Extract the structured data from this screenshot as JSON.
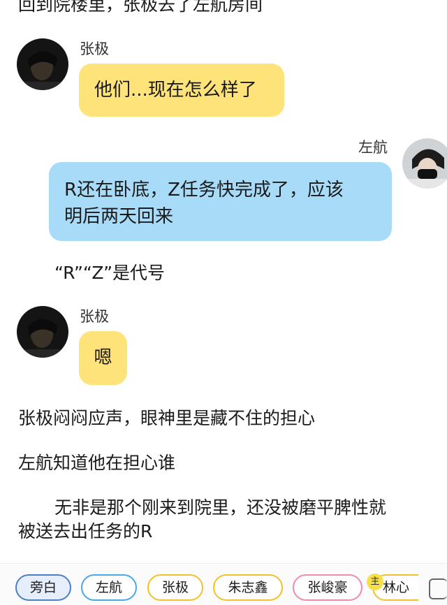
{
  "narration": {
    "top": "回到院楼里，张极去了左航房间",
    "code_note": "“R”“Z”是代号",
    "line1": "张极闷闷应声，眼神里是藏不住的担心",
    "line2": "左航知道他在担心谁",
    "line3a": "无非是那个刚来到院里，还没被磨平脾性就",
    "line3b": "被送去出任务的R"
  },
  "messages": [
    {
      "speaker": "张极",
      "text": "他们...现在怎么样了",
      "color": "#fde37a"
    },
    {
      "speaker": "左航",
      "text_line1": "R还在卧底，Z任务快完成了，应该",
      "text_line2": "明后两天回来",
      "color": "#a7dbf8"
    },
    {
      "speaker": "张极",
      "text": "嗯",
      "color": "#fde37a"
    }
  ],
  "role_bar": {
    "roles": [
      "旁白",
      "左航",
      "张极",
      "朱志鑫",
      "张峻豪",
      "林心"
    ],
    "host_badge": "主",
    "border_colors": [
      "#4a7fc8",
      "#4aa8e8",
      "#f0c12a",
      "#f0c12a",
      "#f08ab0",
      "#f0c12a"
    ],
    "selected": "旁白"
  }
}
